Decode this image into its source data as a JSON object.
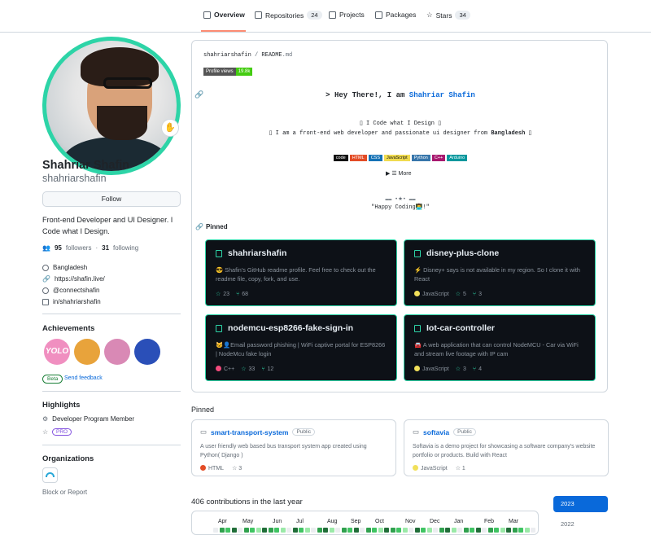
{
  "nav": {
    "tabs": [
      {
        "label": "Overview"
      },
      {
        "label": "Repositories",
        "count": "24"
      },
      {
        "label": "Projects"
      },
      {
        "label": "Packages"
      },
      {
        "label": "Stars",
        "count": "34"
      }
    ]
  },
  "profile": {
    "name": "Shahriar Shafin",
    "login": "shahriarshafin",
    "status_emoji": "✋",
    "follow_label": "Follow",
    "bio": "Front-end Developer and UI Designer. I Code what I Design.",
    "followers": "95",
    "followers_label": "followers",
    "following": "31",
    "following_label": "following",
    "separator": "·",
    "location": "Bangladesh",
    "website": "https://shafin.live/",
    "twitter": "@connectshafin",
    "linkedin": "in/shahriarshafin"
  },
  "achievements": {
    "title": "Achievements",
    "beta": "Beta",
    "feedback": "Send feedback",
    "badges": [
      {
        "text": "YOLO",
        "color": "#f08fc0"
      },
      {
        "text": "",
        "color": "#e8a33b"
      },
      {
        "text": "",
        "color": "#d989b5"
      },
      {
        "text": "",
        "color": "#2a4fb8"
      }
    ]
  },
  "highlights": {
    "title": "Highlights",
    "item": "Developer Program Member",
    "pro": "PRO"
  },
  "organizations": {
    "title": "Organizations",
    "block": "Block or Report"
  },
  "readme": {
    "path_user": "shahriarshafin",
    "path_sep": " / ",
    "path_file": "README",
    "path_ext": ".md",
    "views_label": "Profile views",
    "views_value": "19.8k",
    "greeting_prefix": "> Hey There!, I am ",
    "greeting_name": "Shahriar Shafin",
    "line1": "▯ I Code what I Design ▯",
    "line2_pre": "▯ I am a front-end web developer and passionate ui designer from ",
    "line2_bold": "Bangladesh",
    "line2_post": " ▯",
    "langs": [
      {
        "label": "code",
        "color": "#111"
      },
      {
        "label": "HTML",
        "color": "#e34c26"
      },
      {
        "label": "CSS",
        "color": "#1572b6"
      },
      {
        "label": "JavaScript",
        "color": "#f0db4f"
      },
      {
        "label": "Python",
        "color": "#3776ab"
      },
      {
        "label": "C++",
        "color": "#a8186e"
      },
      {
        "label": "Arduino",
        "color": "#00979d"
      }
    ],
    "more": "▶ ☰ More",
    "sep_line": "▬▬ •★• ▬▬",
    "quote": "\"Happy Coding👨‍💻!\""
  },
  "pinned_dark": {
    "title": "Pinned",
    "cards": [
      {
        "name": "shahriarshafin",
        "desc": "😎 Shafin's GitHub readme profile. Feel free to check out the readme file, copy, fork, and use.",
        "lang": "",
        "lang_color": "",
        "stars": "23",
        "forks": "68"
      },
      {
        "name": "disney-plus-clone",
        "desc": "⚡ Disney+ says is not available in my region. So I clone it with React",
        "lang": "JavaScript",
        "lang_color": "#f1e05a",
        "stars": "5",
        "forks": "3"
      },
      {
        "name": "nodemcu-esp8266-fake-sign-in",
        "desc": "🐱‍👤Email password phishing | WiFi captive portal for ESP8266 | NodeMcu fake login",
        "lang": "C++",
        "lang_color": "#f34b7d",
        "stars": "33",
        "forks": "12"
      },
      {
        "name": "Iot-car-controller",
        "desc": "🚘 A web application that can control NodeMCU - Car via WiFi and stream live footage with IP cam",
        "lang": "JavaScript",
        "lang_color": "#f1e05a",
        "stars": "3",
        "forks": "4"
      }
    ]
  },
  "pinned": {
    "title": "Pinned",
    "cards": [
      {
        "name": "smart-transport-system",
        "badge": "Public",
        "desc": "A user friendly web based bus transport system app created using Python( Django )",
        "lang": "HTML",
        "lang_color": "#e34c26",
        "stars": "3"
      },
      {
        "name": "softavia",
        "badge": "Public",
        "desc": "Softavia is a demo project for showcasing a software company's website portfolio or products. Build with React",
        "lang": "JavaScript",
        "lang_color": "#f1e05a",
        "stars": "1"
      }
    ]
  },
  "contrib": {
    "title": "406 contributions in the last year",
    "months": [
      "Apr",
      "May",
      "Jun",
      "Jul",
      "Aug",
      "Sep",
      "Oct",
      "Nov",
      "Dec",
      "Jan",
      "Feb",
      "Mar"
    ],
    "years": [
      "2023",
      "2022"
    ]
  }
}
